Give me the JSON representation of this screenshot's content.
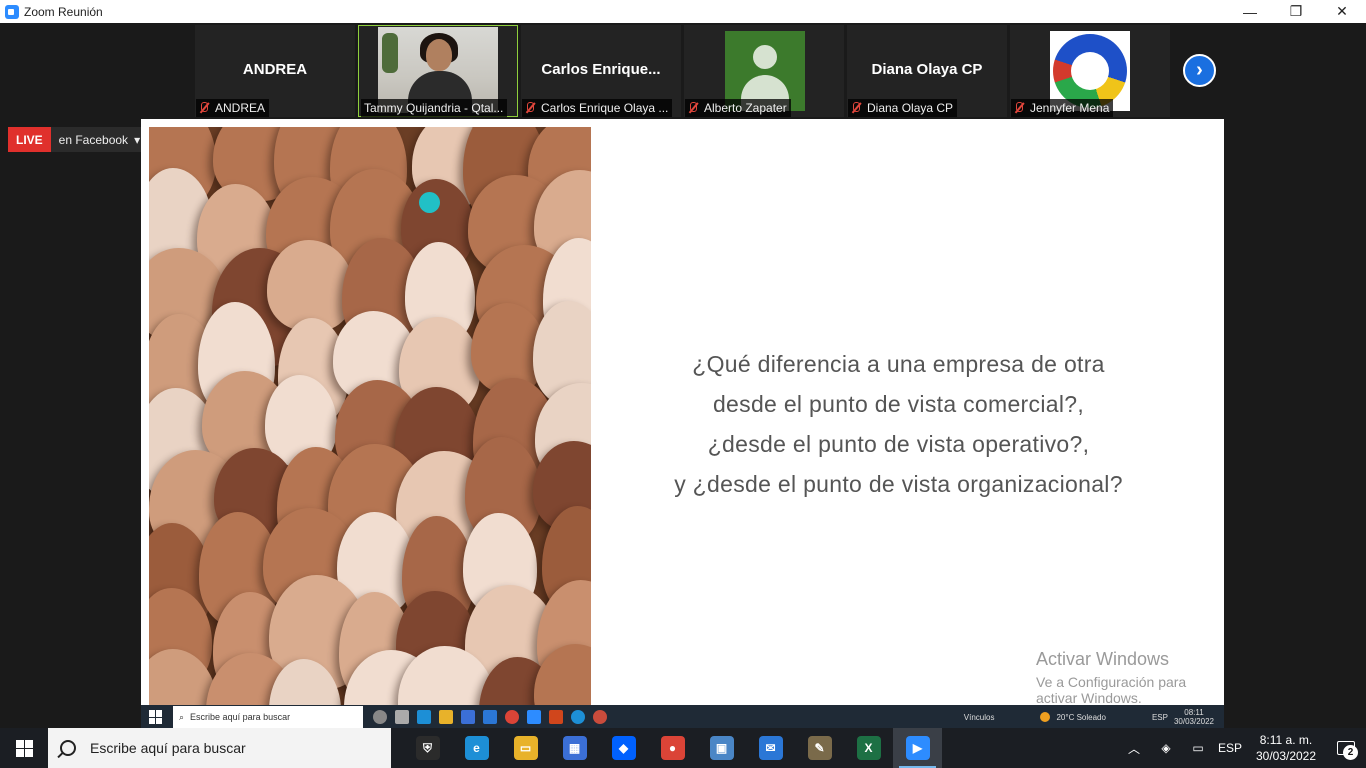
{
  "window": {
    "title": "Zoom Reunión",
    "minimize_glyph": "—",
    "maximize_glyph": "❐",
    "close_glyph": "✕"
  },
  "participants": [
    {
      "display": "ANDREA",
      "tag": "ANDREA",
      "muted": true,
      "kind": "name"
    },
    {
      "display": "",
      "tag": "Tammy Quijandria - Qtal...",
      "muted": false,
      "kind": "video"
    },
    {
      "display": "Carlos  Enrique...",
      "tag": "Carlos Enrique Olaya ...",
      "muted": true,
      "kind": "name"
    },
    {
      "display": "",
      "tag": "Alberto Zapater",
      "muted": true,
      "kind": "avatar-green"
    },
    {
      "display": "Diana Olaya CP",
      "tag": "Diana Olaya CP",
      "muted": true,
      "kind": "name"
    },
    {
      "display": "",
      "tag": "Jennyfer Mena",
      "muted": true,
      "kind": "avatar-logo"
    }
  ],
  "next_glyph": "›",
  "live": {
    "badge": "LIVE",
    "target": "en Facebook",
    "caret": "▾"
  },
  "slide": {
    "lines": [
      "¿Qué diferencia a una empresa de otra",
      "desde el punto de vista comercial?,",
      "¿desde el punto de vista operativo?,",
      "y ¿desde el punto de vista organizacional?"
    ]
  },
  "watermark": {
    "line1": "Activar Windows",
    "line2": "Ve a Configuración para activar Windows."
  },
  "shared_taskbar": {
    "search": "Escribe aquí para buscar",
    "links": "Vínculos",
    "weather": "20°C  Soleado",
    "lang": "ESP",
    "time": "08:11",
    "date": "30/03/2022"
  },
  "taskbar": {
    "search_placeholder": "Escribe aquí para buscar",
    "lang": "ESP",
    "time": "8:11 a. m.",
    "date": "30/03/2022",
    "notifications": "2",
    "apps": [
      {
        "name": "security",
        "color": "#2b2b2b",
        "glyph": "⛨"
      },
      {
        "name": "edge",
        "color": "#1d8fd6",
        "glyph": "e"
      },
      {
        "name": "file-explorer",
        "color": "#e8b22a",
        "glyph": "▭"
      },
      {
        "name": "store",
        "color": "#3b6fd6",
        "glyph": "▦"
      },
      {
        "name": "dropbox",
        "color": "#0061fe",
        "glyph": "◆"
      },
      {
        "name": "chrome",
        "color": "#db4437",
        "glyph": "●"
      },
      {
        "name": "control-panel",
        "color": "#4a86c6",
        "glyph": "▣"
      },
      {
        "name": "mail",
        "color": "#2b77d6",
        "glyph": "✉"
      },
      {
        "name": "paint",
        "color": "#7a6a4a",
        "glyph": "✎"
      },
      {
        "name": "excel",
        "color": "#1d7044",
        "glyph": "X"
      },
      {
        "name": "zoom",
        "color": "#2d8cff",
        "glyph": "▶"
      }
    ]
  },
  "colors": {
    "accent": "#2d8cff",
    "live_red": "#e0302c",
    "pointer": "#21c0c6",
    "active_tile": "#8fcf3c"
  }
}
